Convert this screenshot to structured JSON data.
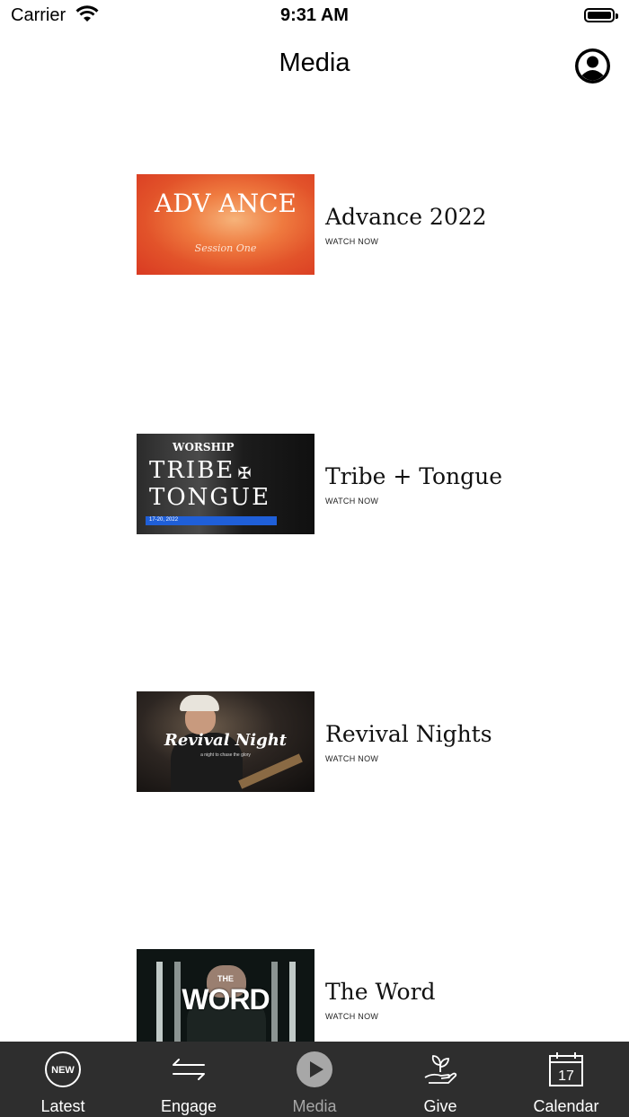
{
  "status_bar": {
    "carrier": "Carrier",
    "time": "9:31 AM"
  },
  "nav": {
    "title": "Media"
  },
  "media_items": [
    {
      "title": "Advance 2022",
      "subtitle": "WATCH NOW",
      "thumb_text": "ADV ANCE",
      "thumb_script": "Session One"
    },
    {
      "title": "Tribe + Tongue",
      "subtitle": "WATCH NOW",
      "thumb_text_1": "WORSHIP",
      "thumb_text_2": "TRIBE",
      "thumb_text_3": "TONGUE",
      "thumb_bar": "17-20, 2022"
    },
    {
      "title": "Revival Nights",
      "subtitle": "WATCH NOW",
      "thumb_text": "Revival Night",
      "thumb_sub": "a night to chase the glory"
    },
    {
      "title": "The Word",
      "subtitle": "WATCH NOW",
      "thumb_the": "THE",
      "thumb_word": "WORD"
    }
  ],
  "tabs": [
    {
      "label": "Latest",
      "icon": "new-badge-icon",
      "icon_text": "NEW"
    },
    {
      "label": "Engage",
      "icon": "swap-arrows-icon"
    },
    {
      "label": "Media",
      "icon": "play-circle-icon",
      "active": true
    },
    {
      "label": "Give",
      "icon": "hand-plant-icon"
    },
    {
      "label": "Calendar",
      "icon": "calendar-icon",
      "icon_text": "17"
    }
  ],
  "colors": {
    "tab_bar_bg": "#2e2e2e",
    "tab_active": "#a7a7a7",
    "tab_inactive": "#ffffff"
  }
}
